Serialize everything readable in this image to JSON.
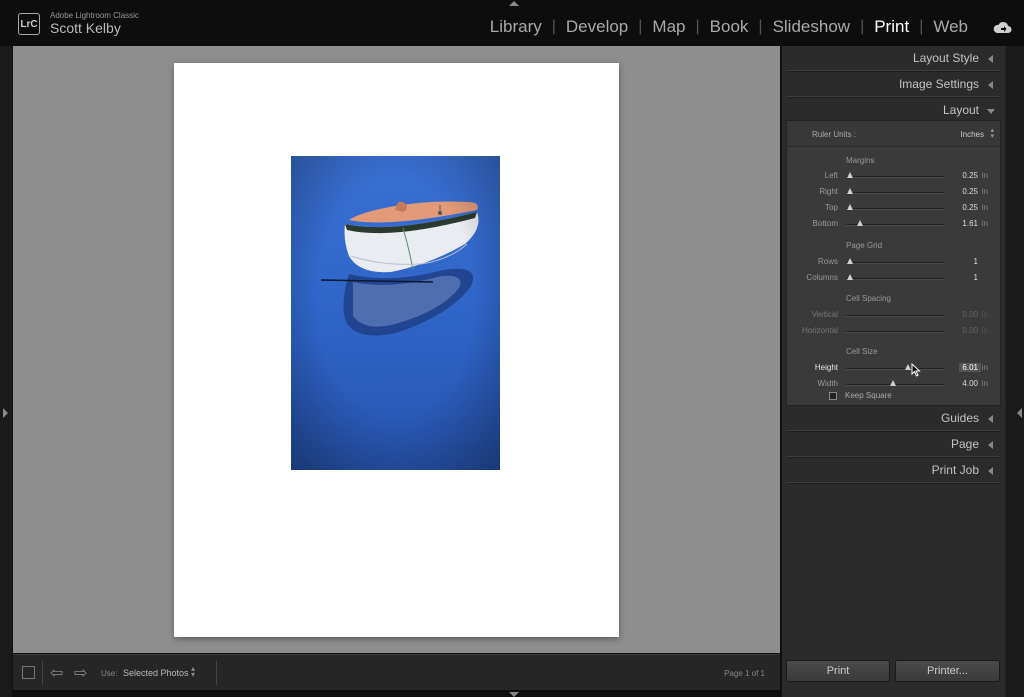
{
  "app": {
    "logo_text": "LrC",
    "product_name": "Adobe Lightroom Classic",
    "user_name": "Scott Kelby"
  },
  "modules": [
    {
      "label": "Library",
      "active": false
    },
    {
      "label": "Develop",
      "active": false
    },
    {
      "label": "Map",
      "active": false
    },
    {
      "label": "Book",
      "active": false
    },
    {
      "label": "Slideshow",
      "active": false
    },
    {
      "label": "Print",
      "active": true
    },
    {
      "label": "Web",
      "active": false
    }
  ],
  "panels": {
    "layout_style": "Layout Style",
    "image_settings": "Image Settings",
    "layout": "Layout",
    "guides": "Guides",
    "page": "Page",
    "print_job": "Print Job"
  },
  "layout": {
    "ruler_units_label": "Ruler Units :",
    "ruler_units_value": "Inches",
    "margins_title": "Margins",
    "margins": {
      "left": {
        "label": "Left",
        "value": "0.25",
        "unit": "in",
        "pos": 0.04
      },
      "right": {
        "label": "Right",
        "value": "0.25",
        "unit": "in",
        "pos": 0.04
      },
      "top": {
        "label": "Top",
        "value": "0.25",
        "unit": "in",
        "pos": 0.04
      },
      "bottom": {
        "label": "Bottom",
        "value": "1.61",
        "unit": "in",
        "pos": 0.14
      }
    },
    "page_grid_title": "Page Grid",
    "rows": {
      "label": "Rows",
      "value": "1",
      "pos": 0.04
    },
    "columns": {
      "label": "Columns",
      "value": "1",
      "pos": 0.04
    },
    "cell_spacing_title": "Cell Spacing",
    "vertical": {
      "label": "Vertical",
      "value": "0.00",
      "unit": "in"
    },
    "horizontal": {
      "label": "Horizontal",
      "value": "0.00",
      "unit": "in"
    },
    "cell_size_title": "Cell Size",
    "height": {
      "label": "Height",
      "value": "6.01",
      "unit": "in",
      "pos": 0.63
    },
    "width": {
      "label": "Width",
      "value": "4.00",
      "unit": "in",
      "pos": 0.48
    },
    "keep_square_label": "Keep Square",
    "keep_square_checked": false
  },
  "toolbar": {
    "use_label": "Use:",
    "use_value": "Selected Photos",
    "page_info": "Page 1 of 1"
  },
  "buttons": {
    "print": "Print",
    "printer": "Printer..."
  },
  "colors": {
    "active_module": "#ffffff",
    "inactive_module": "#aaaaaa",
    "canvas_bg": "#8e8e8e",
    "photo_sky": "#2f65cc"
  }
}
